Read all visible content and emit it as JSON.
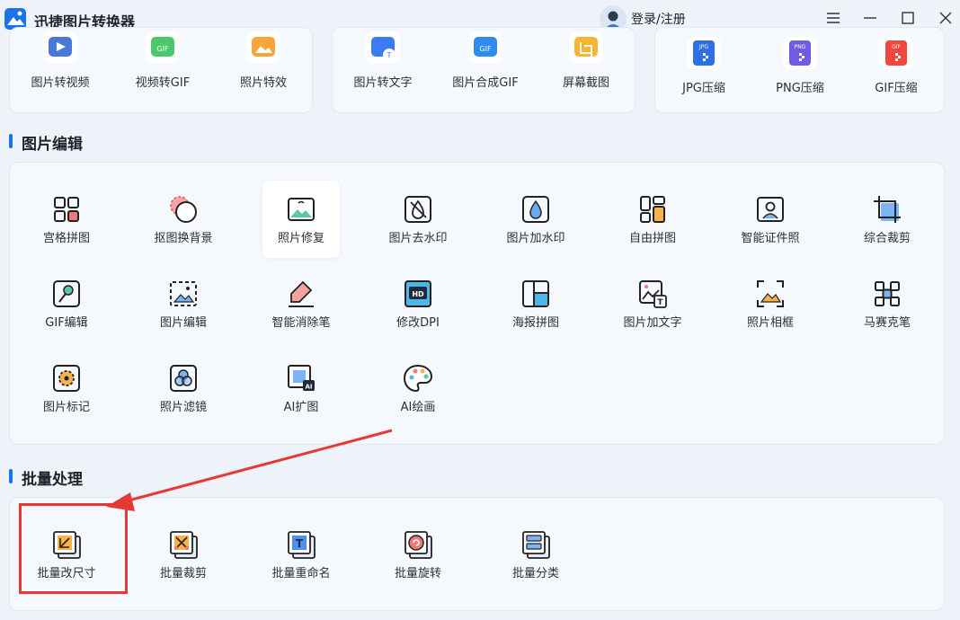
{
  "app": {
    "title": "迅捷图片转换器",
    "login_label": "登录/注册"
  },
  "window_controls": {
    "menu_icon": "menu-icon",
    "minimize_icon": "minimize-icon",
    "maximize_icon": "maximize-icon",
    "close_icon": "close-icon"
  },
  "top_group_1": [
    {
      "label": "图片转视频",
      "icon": "image-to-video-icon"
    },
    {
      "label": "视频转GIF",
      "icon": "video-to-gif-icon"
    },
    {
      "label": "照片特效",
      "icon": "photo-effects-icon"
    }
  ],
  "top_group_2": [
    {
      "label": "图片转文字",
      "icon": "image-to-text-icon"
    },
    {
      "label": "图片合成GIF",
      "icon": "images-to-gif-icon"
    },
    {
      "label": "屏幕截图",
      "icon": "screenshot-icon"
    }
  ],
  "top_group_3": [
    {
      "label": "JPG压缩",
      "icon": "jpg-compress-icon",
      "badge": "JPG"
    },
    {
      "label": "PNG压缩",
      "icon": "png-compress-icon",
      "badge": "PNG"
    },
    {
      "label": "GIF压缩",
      "icon": "gif-compress-icon",
      "badge": "GIF"
    }
  ],
  "edit_section": {
    "title": "图片编辑",
    "items": [
      {
        "label": "宫格拼图",
        "icon": "grid-puzzle-icon"
      },
      {
        "label": "抠图换背景",
        "icon": "cutout-background-icon"
      },
      {
        "label": "照片修复",
        "icon": "photo-repair-icon"
      },
      {
        "label": "图片去水印",
        "icon": "remove-watermark-icon"
      },
      {
        "label": "图片加水印",
        "icon": "add-watermark-icon"
      },
      {
        "label": "自由拼图",
        "icon": "free-collage-icon"
      },
      {
        "label": "智能证件照",
        "icon": "id-photo-icon"
      },
      {
        "label": "综合裁剪",
        "icon": "crop-icon"
      },
      {
        "label": "GIF编辑",
        "icon": "gif-edit-icon"
      },
      {
        "label": "图片编辑",
        "icon": "image-edit-icon"
      },
      {
        "label": "智能消除笔",
        "icon": "eraser-pen-icon"
      },
      {
        "label": "修改DPI",
        "icon": "hd-dpi-icon"
      },
      {
        "label": "海报拼图",
        "icon": "poster-collage-icon"
      },
      {
        "label": "图片加文字",
        "icon": "add-text-icon"
      },
      {
        "label": "照片相框",
        "icon": "photo-frame-icon"
      },
      {
        "label": "马赛克笔",
        "icon": "mosaic-icon"
      },
      {
        "label": "图片标记",
        "icon": "image-mark-icon"
      },
      {
        "label": "照片滤镜",
        "icon": "photo-filter-icon"
      },
      {
        "label": "AI扩图",
        "icon": "ai-expand-icon"
      },
      {
        "label": "AI绘画",
        "icon": "ai-paint-icon"
      }
    ]
  },
  "batch_section": {
    "title": "批量处理",
    "items": [
      {
        "label": "批量改尺寸",
        "icon": "batch-resize-icon"
      },
      {
        "label": "批量裁剪",
        "icon": "batch-crop-icon"
      },
      {
        "label": "批量重命名",
        "icon": "batch-rename-icon"
      },
      {
        "label": "批量旋转",
        "icon": "batch-rotate-icon"
      },
      {
        "label": "批量分类",
        "icon": "batch-classify-icon"
      }
    ]
  },
  "colors": {
    "accent": "#1a73e8",
    "annotation": "#e53935",
    "panel": "#f5f8fd",
    "background": "#eef2f9"
  }
}
